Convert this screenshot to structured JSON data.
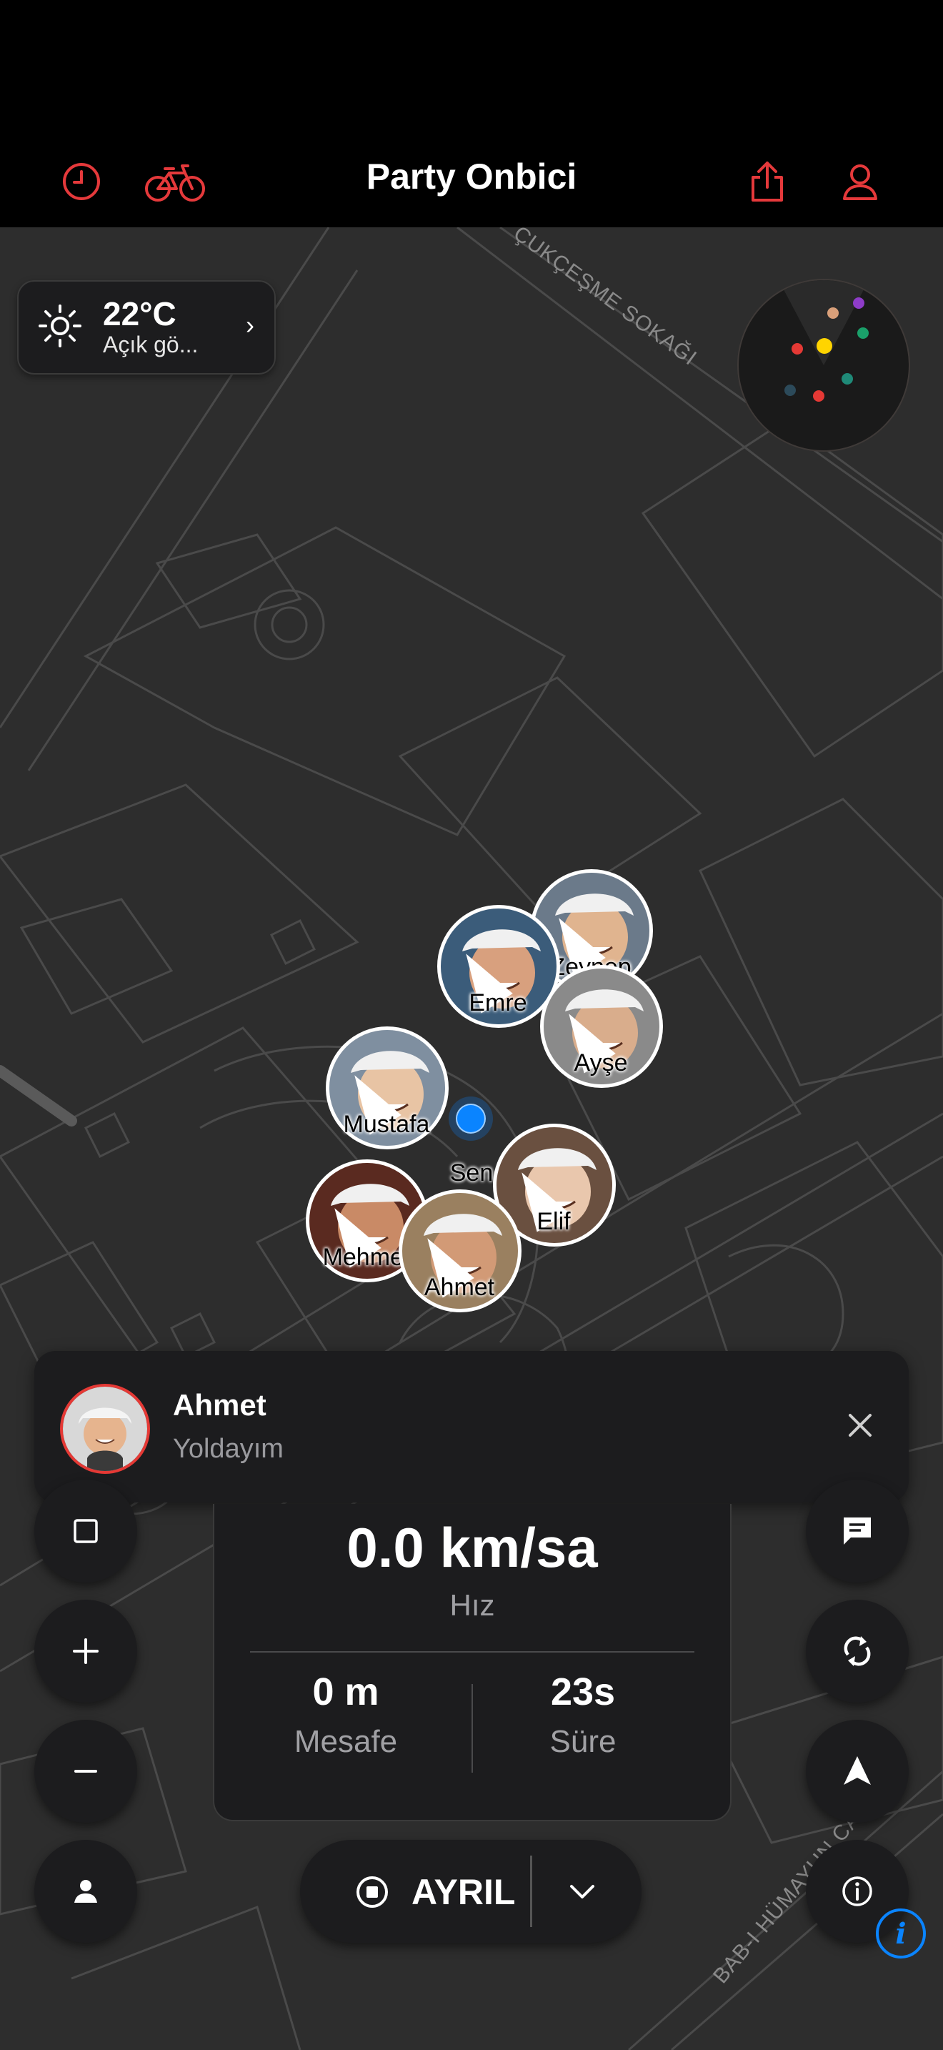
{
  "app": {
    "title": "Party Onbici",
    "nav_icons": [
      "clock-icon",
      "bicycle-icon",
      "share-icon",
      "profile-icon"
    ],
    "accent_color": "#e5393b"
  },
  "weather": {
    "temperature": "22°C",
    "condition": "Açık gö..."
  },
  "map": {
    "streets": [
      "ÇUKÇEŞME SOKAĞI",
      "BAB-I HÜMAYUN CADDESİ"
    ]
  },
  "radar": {
    "dot_colors": [
      "#d9a07a",
      "#8e3cc8",
      "#1aa06a",
      "#ffd400",
      "#e53935",
      "#1f8a78",
      "#e53935",
      "#2c4a5a"
    ]
  },
  "members": [
    {
      "name": "Zeynep"
    },
    {
      "name": "Emre"
    },
    {
      "name": "Ayşe"
    },
    {
      "name": "Mustafa"
    },
    {
      "name": "Elif"
    },
    {
      "name": "Mehmet"
    },
    {
      "name": "Ahmet"
    }
  ],
  "self": {
    "label": "Sen",
    "color": "#0a84ff"
  },
  "notification": {
    "sender": "Ahmet",
    "message": "Yoldayım"
  },
  "stats": {
    "speed": "0.0 km/sa",
    "speed_label": "Hız",
    "distance": "0 m",
    "distance_label": "Mesafe",
    "duration": "23s",
    "duration_label": "Süre"
  },
  "controls": {
    "left": [
      "square-icon",
      "zoom-in-icon",
      "zoom-out-icon",
      "person-icon"
    ],
    "right": [
      "chat-icon",
      "refresh-icon",
      "navigate-arrow-icon",
      "info-icon"
    ]
  },
  "leave": {
    "label": "AYRIL"
  },
  "map_info_badge": "i"
}
